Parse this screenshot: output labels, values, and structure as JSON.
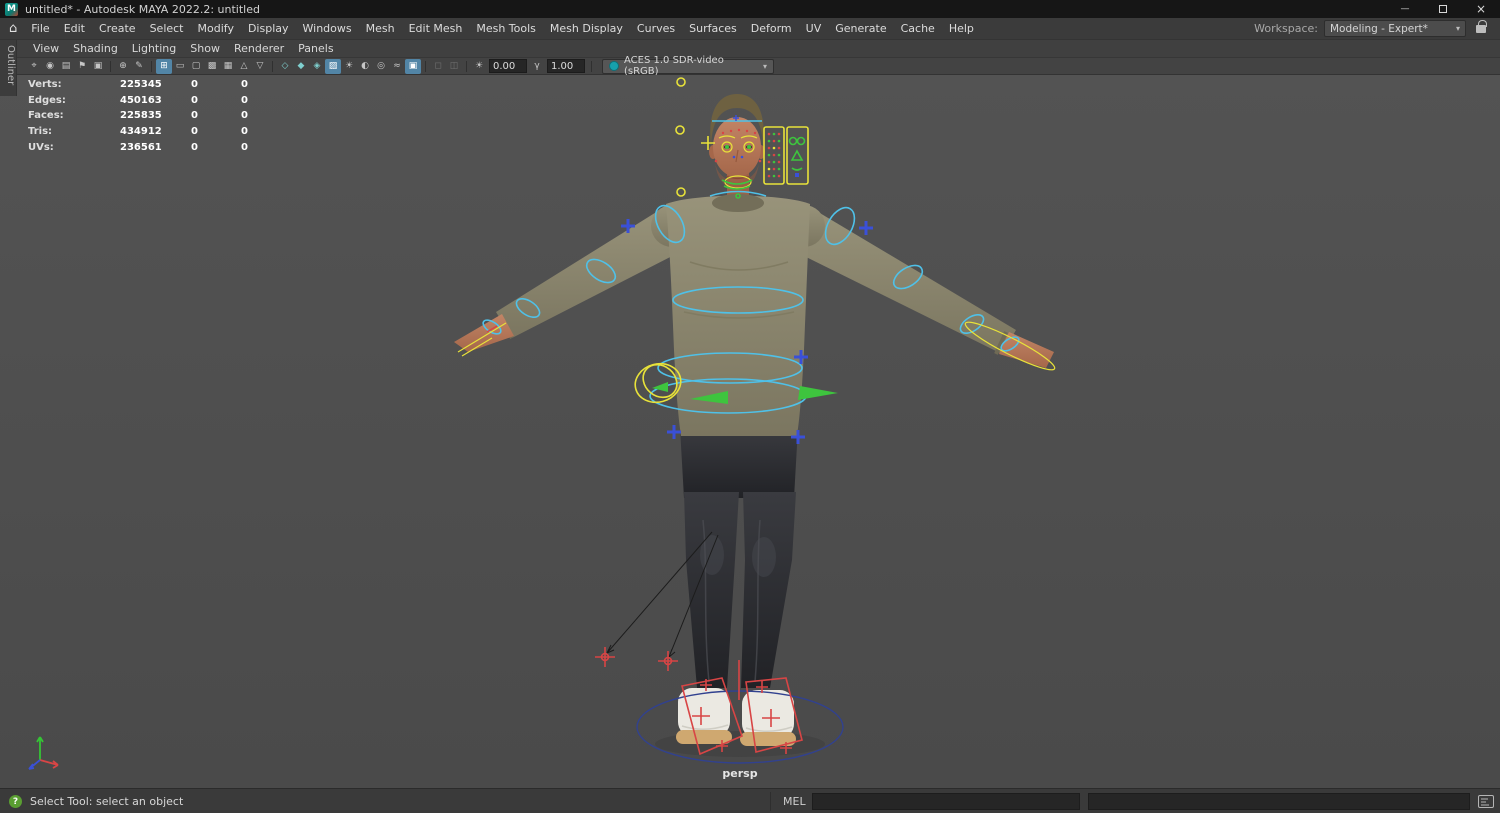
{
  "window": {
    "title": "untitled* - Autodesk MAYA 2022.2: untitled"
  },
  "glyphs": {
    "logo": "M",
    "home": "⌂",
    "caret": "▾",
    "help": "?",
    "minimize": "—",
    "close": "×",
    "exposure_icon": "☀",
    "gamma_icon": "γ"
  },
  "menu_bar": {
    "items": [
      {
        "name": "menu-file",
        "label": "File"
      },
      {
        "name": "menu-edit",
        "label": "Edit"
      },
      {
        "name": "menu-create",
        "label": "Create"
      },
      {
        "name": "menu-select",
        "label": "Select"
      },
      {
        "name": "menu-modify",
        "label": "Modify"
      },
      {
        "name": "menu-display",
        "label": "Display"
      },
      {
        "name": "menu-windows",
        "label": "Windows"
      },
      {
        "name": "menu-mesh",
        "label": "Mesh"
      },
      {
        "name": "menu-edit-mesh",
        "label": "Edit Mesh"
      },
      {
        "name": "menu-mesh-tools",
        "label": "Mesh Tools"
      },
      {
        "name": "menu-mesh-display",
        "label": "Mesh Display"
      },
      {
        "name": "menu-curves",
        "label": "Curves"
      },
      {
        "name": "menu-surfaces",
        "label": "Surfaces"
      },
      {
        "name": "menu-deform",
        "label": "Deform"
      },
      {
        "name": "menu-uv",
        "label": "UV"
      },
      {
        "name": "menu-generate",
        "label": "Generate"
      },
      {
        "name": "menu-cache",
        "label": "Cache"
      },
      {
        "name": "menu-help",
        "label": "Help"
      }
    ],
    "workspace_label": "Workspace:",
    "workspace_value": "Modeling - Expert*"
  },
  "panel_menu": {
    "items": [
      {
        "name": "panel-menu-view",
        "label": "View"
      },
      {
        "name": "panel-menu-shading",
        "label": "Shading"
      },
      {
        "name": "panel-menu-lighting",
        "label": "Lighting"
      },
      {
        "name": "panel-menu-show",
        "label": "Show"
      },
      {
        "name": "panel-menu-renderer",
        "label": "Renderer"
      },
      {
        "name": "panel-menu-panels",
        "label": "Panels"
      }
    ]
  },
  "panel_toolbar": {
    "icons": [
      {
        "name": "select-camera-icon",
        "glyph": "⌖",
        "cls": "ticon",
        "inter": "true"
      },
      {
        "name": "lock-camera-icon",
        "glyph": "◉",
        "cls": "ticon",
        "inter": "true"
      },
      {
        "name": "camera-attributes-icon",
        "glyph": "▤",
        "cls": "ticon",
        "inter": "true"
      },
      {
        "name": "bookmark-icon",
        "glyph": "⚑",
        "cls": "ticon",
        "inter": "true"
      },
      {
        "name": "image-plane-icon",
        "glyph": "▣",
        "cls": "ticon",
        "inter": "true"
      },
      {
        "name": "toolbar-separator",
        "glyph": "",
        "cls": "tsep",
        "inter": "false"
      },
      {
        "name": "2d-pan-zoom-icon",
        "glyph": "⊕",
        "cls": "ticon",
        "inter": "true"
      },
      {
        "name": "grease-pencil-icon",
        "glyph": "✎",
        "cls": "ticon",
        "inter": "true"
      },
      {
        "name": "toolbar-separator",
        "glyph": "",
        "cls": "tsep",
        "inter": "false"
      },
      {
        "name": "grid-icon",
        "glyph": "⊞",
        "cls": "ticon active",
        "inter": "true"
      },
      {
        "name": "film-gate-icon",
        "glyph": "▭",
        "cls": "ticon",
        "inter": "true"
      },
      {
        "name": "resolution-gate-icon",
        "glyph": "▢",
        "cls": "ticon",
        "inter": "true"
      },
      {
        "name": "gate-mask-icon",
        "glyph": "▩",
        "cls": "ticon",
        "inter": "true"
      },
      {
        "name": "field-chart-icon",
        "glyph": "▦",
        "cls": "ticon",
        "inter": "true"
      },
      {
        "name": "safe-action-icon",
        "glyph": "△",
        "cls": "ticon",
        "inter": "true"
      },
      {
        "name": "safe-title-icon",
        "glyph": "▽",
        "cls": "ticon",
        "inter": "true"
      },
      {
        "name": "toolbar-separator",
        "glyph": "",
        "cls": "tsep",
        "inter": "false"
      },
      {
        "name": "wireframe-icon",
        "glyph": "◇",
        "cls": "ticon teal",
        "inter": "true"
      },
      {
        "name": "smooth-shade-icon",
        "glyph": "◆",
        "cls": "ticon teal",
        "inter": "true"
      },
      {
        "name": "wireframe-on-shaded-icon",
        "glyph": "◈",
        "cls": "ticon teal",
        "inter": "true"
      },
      {
        "name": "textured-icon",
        "glyph": "▨",
        "cls": "ticon teal active",
        "inter": "true"
      },
      {
        "name": "use-all-lights-icon",
        "glyph": "☀",
        "cls": "ticon",
        "inter": "true"
      },
      {
        "name": "shadows-icon",
        "glyph": "◐",
        "cls": "ticon",
        "inter": "true"
      },
      {
        "name": "screen-space-ao-icon",
        "glyph": "◎",
        "cls": "ticon",
        "inter": "true"
      },
      {
        "name": "motion-blur-icon",
        "glyph": "≈",
        "cls": "ticon",
        "inter": "true"
      },
      {
        "name": "anti-alias-icon",
        "glyph": "▣",
        "cls": "ticon active",
        "inter": "true"
      },
      {
        "name": "toolbar-separator",
        "glyph": "",
        "cls": "tsep",
        "inter": "false"
      },
      {
        "name": "isolate-select-icon",
        "glyph": "◻",
        "cls": "ticon disabled",
        "inter": "true"
      },
      {
        "name": "x-ray-icon",
        "glyph": "◫",
        "cls": "ticon disabled",
        "inter": "true"
      },
      {
        "name": "toolbar-separator",
        "glyph": "",
        "cls": "tsep",
        "inter": "false"
      }
    ],
    "exposure": "0.00",
    "gamma": "1.00",
    "colorspace": "ACES 1.0 SDR-video (sRGB)"
  },
  "outliner": {
    "label": "Outliner"
  },
  "hud": {
    "rows": [
      {
        "name": "hud-verts",
        "label": "Verts:",
        "value": "225345",
        "c2": "0",
        "c3": "0"
      },
      {
        "name": "hud-edges",
        "label": "Edges:",
        "value": "450163",
        "c2": "0",
        "c3": "0"
      },
      {
        "name": "hud-faces",
        "label": "Faces:",
        "value": "225835",
        "c2": "0",
        "c3": "0"
      },
      {
        "name": "hud-tris",
        "label": "Tris:",
        "value": "434912",
        "c2": "0",
        "c3": "0"
      },
      {
        "name": "hud-uvs",
        "label": "UVs:",
        "value": "236561",
        "c2": "0",
        "c3": "0"
      }
    ]
  },
  "viewport": {
    "camera_label": "persp"
  },
  "status_bar": {
    "help_text": "Select Tool: select an object",
    "mel_label": "MEL",
    "command_value": "",
    "result_value": ""
  },
  "colors": {
    "rig-cyan": "#4fc1e8",
    "rig-yellow": "#e8e23a",
    "rig-green": "#3ec43e",
    "rig-red": "#d84545",
    "rig-blue": "#3a50d8",
    "rig-navy": "#31418f",
    "accent": "#5285a6",
    "viewport-bg": "#4e4e4e"
  }
}
